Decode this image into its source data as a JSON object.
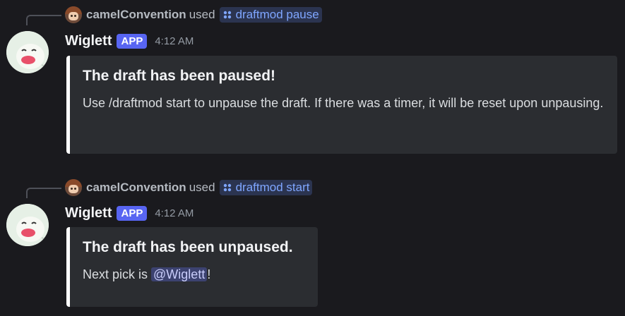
{
  "messages": [
    {
      "reply": {
        "user": "camelConvention",
        "used": "used",
        "command": "draftmod pause"
      },
      "author": "Wiglett",
      "tag": "APP",
      "time": "4:12 AM",
      "embed": {
        "title": "The draft has been paused!",
        "description": "Use /draftmod start to unpause the draft. If there was a timer, it will be reset upon unpausing."
      }
    },
    {
      "reply": {
        "user": "camelConvention",
        "used": "used",
        "command": "draftmod start"
      },
      "author": "Wiglett",
      "tag": "APP",
      "time": "4:12 AM",
      "embed": {
        "title": "The draft has been unpaused.",
        "desc_before": "Next pick is ",
        "mention": "@Wiglett",
        "desc_after": "!"
      }
    }
  ],
  "colors": {
    "background": "#1a1a1e",
    "embed_bg": "#2b2d31",
    "embed_border": "#ffffff",
    "app_tag": "#5865f2",
    "command_text": "#7fa6ff",
    "mention_bg": "#3c4270"
  },
  "icons": {
    "command": "slash-command-icon",
    "avatar": "wiglett-avatar",
    "user_avatar": "user-avatar"
  }
}
